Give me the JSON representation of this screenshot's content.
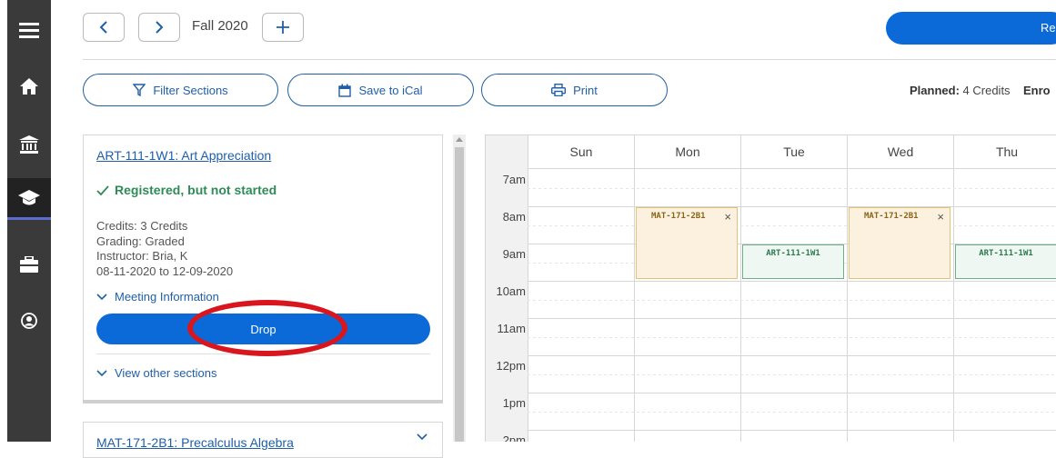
{
  "nav": {
    "items": [
      {
        "icon": "menu-icon"
      },
      {
        "icon": "home-icon"
      },
      {
        "icon": "institution-icon"
      },
      {
        "icon": "graduation-cap-icon",
        "active": true
      },
      {
        "icon": "briefcase-icon"
      },
      {
        "icon": "user-circle-icon"
      }
    ]
  },
  "header": {
    "term": "Fall 2020",
    "register_label": "Re"
  },
  "toolbar": {
    "filter_label": "Filter Sections",
    "ical_label": "Save to iCal",
    "print_label": "Print",
    "planned_label": "Planned:",
    "planned_value": "4 Credits",
    "enrolled_label": "Enro"
  },
  "course_card": {
    "title": "ART-111-1W1: Art Appreciation",
    "status": "Registered, but not started",
    "credits": "Credits: 3 Credits",
    "grading": "Grading: Graded",
    "instructor": "Instructor: Bria, K",
    "dates": "08-11-2020 to 12-09-2020",
    "meeting_toggle": "Meeting Information",
    "drop_label": "Drop",
    "other_sections": "View other sections"
  },
  "course_card_2": {
    "title": "MAT-171-2B1: Precalculus Algebra"
  },
  "calendar": {
    "days": [
      "Sun",
      "Mon",
      "Tue",
      "Wed",
      "Thu"
    ],
    "times": [
      "7am",
      "8am",
      "9am",
      "10am",
      "11am",
      "12pm",
      "1pm",
      "2pm"
    ],
    "events": [
      {
        "code": "MAT-171-2B1",
        "day": "Mon",
        "start": "8am",
        "end": "10am",
        "removable": true
      },
      {
        "code": "ART-111-1W1",
        "day": "Tue",
        "start": "9am",
        "end": "10am",
        "removable": false
      },
      {
        "code": "MAT-171-2B1",
        "day": "Wed",
        "start": "8am",
        "end": "10am",
        "removable": true
      },
      {
        "code": "ART-111-1W1",
        "day": "Thu",
        "start": "9am",
        "end": "10am",
        "removable": false
      }
    ]
  },
  "colors": {
    "accent": "#0b6ad8",
    "registered_green": "#2e8b57",
    "highlight_ring": "#d9161d",
    "mat_event_bg": "#fbf1de",
    "art_event_bg": "#eef7f2"
  }
}
